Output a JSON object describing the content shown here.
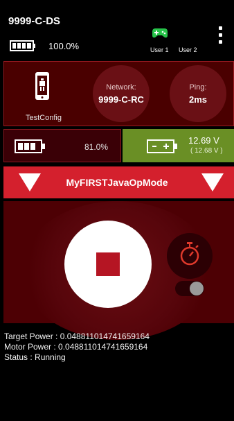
{
  "header": {
    "ds_name": "9999-C-DS",
    "battery_percent": "100.0%",
    "users": [
      "User 1",
      "User 2"
    ]
  },
  "robot": {
    "config": "TestConfig",
    "network_label": "Network:",
    "network_value": "9999-C-RC",
    "ping_label": "Ping:",
    "ping_value": "2ms"
  },
  "battery": {
    "phone_percent": "81.0%",
    "robot_voltage": "12.69 V",
    "robot_voltage_sub": "( 12.68 V )"
  },
  "opmode": {
    "name": "MyFIRSTJavaOpMode"
  },
  "telemetry": {
    "lines": [
      "Target Power : 0.048811014741659164",
      "Motor Power : 0.048811014741659164",
      "Status : Running"
    ]
  },
  "colors": {
    "accent_red": "#d4202d",
    "dark_red": "#4a0000",
    "battery_green": "#6a8f25"
  },
  "icons": {
    "gamepad": "gamepad-icon",
    "menu": "kebab-menu-icon",
    "phone": "robot-phone-icon",
    "stop": "stop-icon",
    "timer": "stopwatch-icon"
  }
}
